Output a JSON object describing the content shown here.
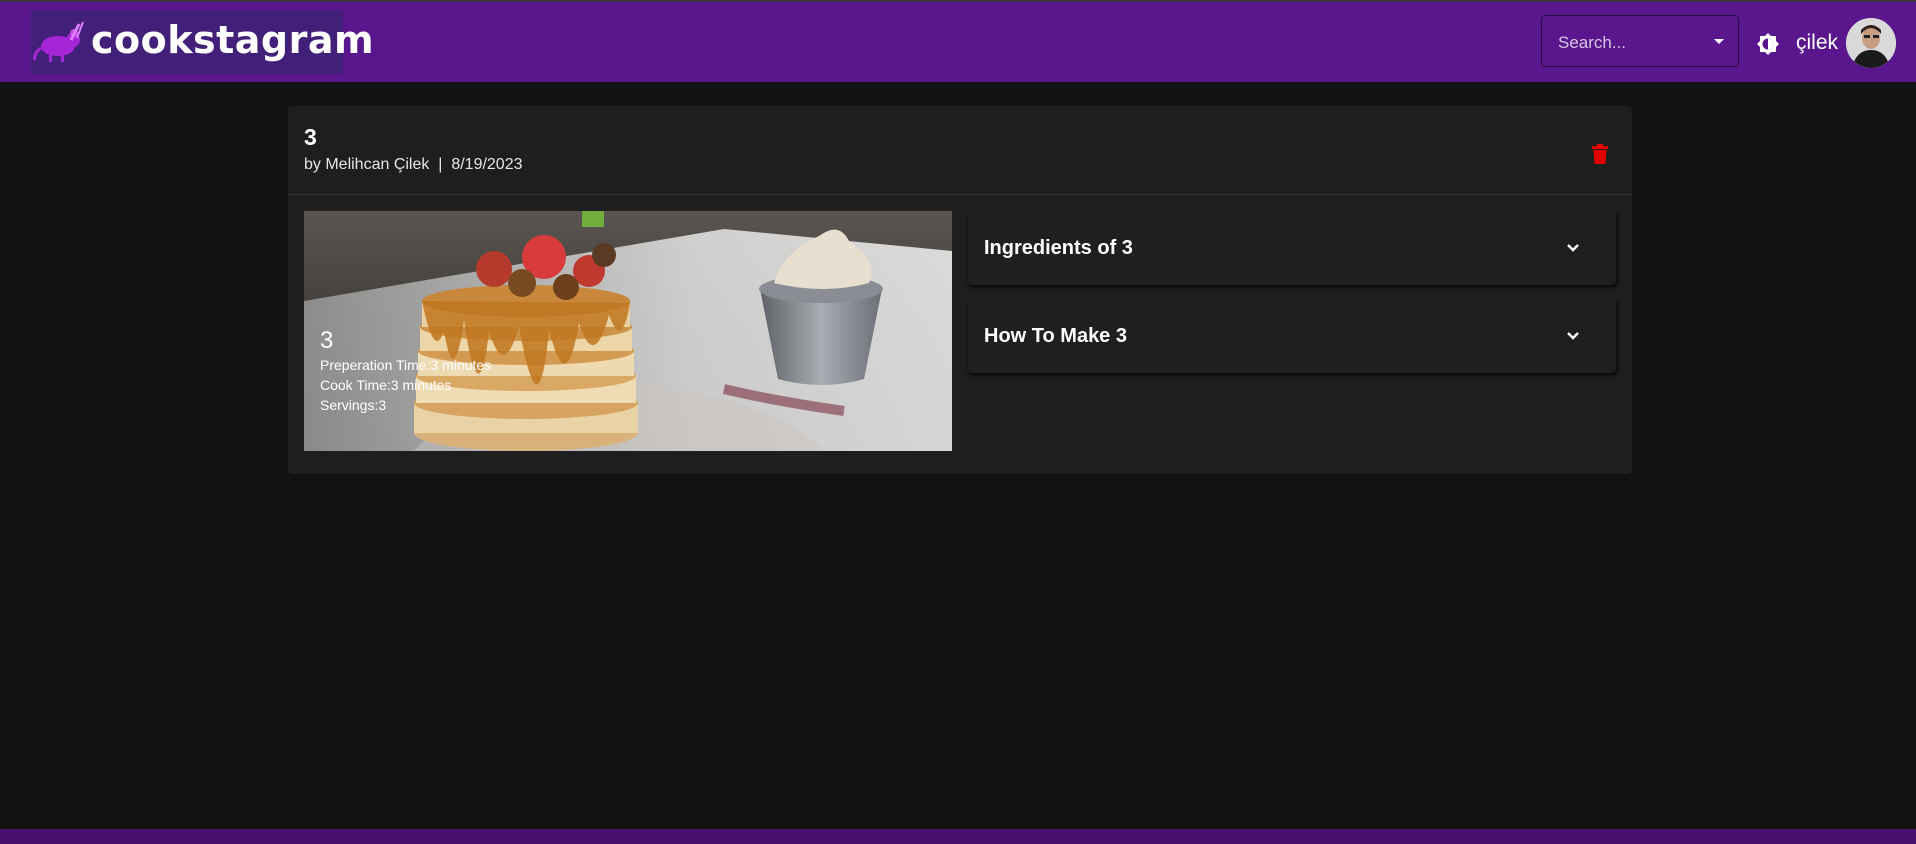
{
  "app": {
    "brand": "cookstagram",
    "search_placeholder": "Search...",
    "username": "çilek"
  },
  "recipe": {
    "title": "3",
    "author": "by Melihcan Çilek",
    "separator": "|",
    "date": "8/19/2023",
    "byline": "by Melihcan Çilek  |  8/19/2023",
    "image_title": "3",
    "prep": "Preperation Time:3 minutes",
    "cook": "Cook Time:3 minutes",
    "servings": "Servings:3"
  },
  "accordion": [
    {
      "label": "Ingredients of 3",
      "icon": "chevron-down-icon"
    },
    {
      "label": "How To Make 3",
      "icon": "chevron-down-icon"
    }
  ],
  "colors": {
    "appbar": "#5a168c",
    "logo_bg": "#42207a",
    "page_bg": "#121212",
    "card_bg": "#1e1e1e",
    "delete": "#e00000",
    "footer": "#4a0e6e"
  },
  "icons": {
    "logo": "rat-chef-icon",
    "theme": "brightness-icon",
    "delete": "trash-icon"
  }
}
